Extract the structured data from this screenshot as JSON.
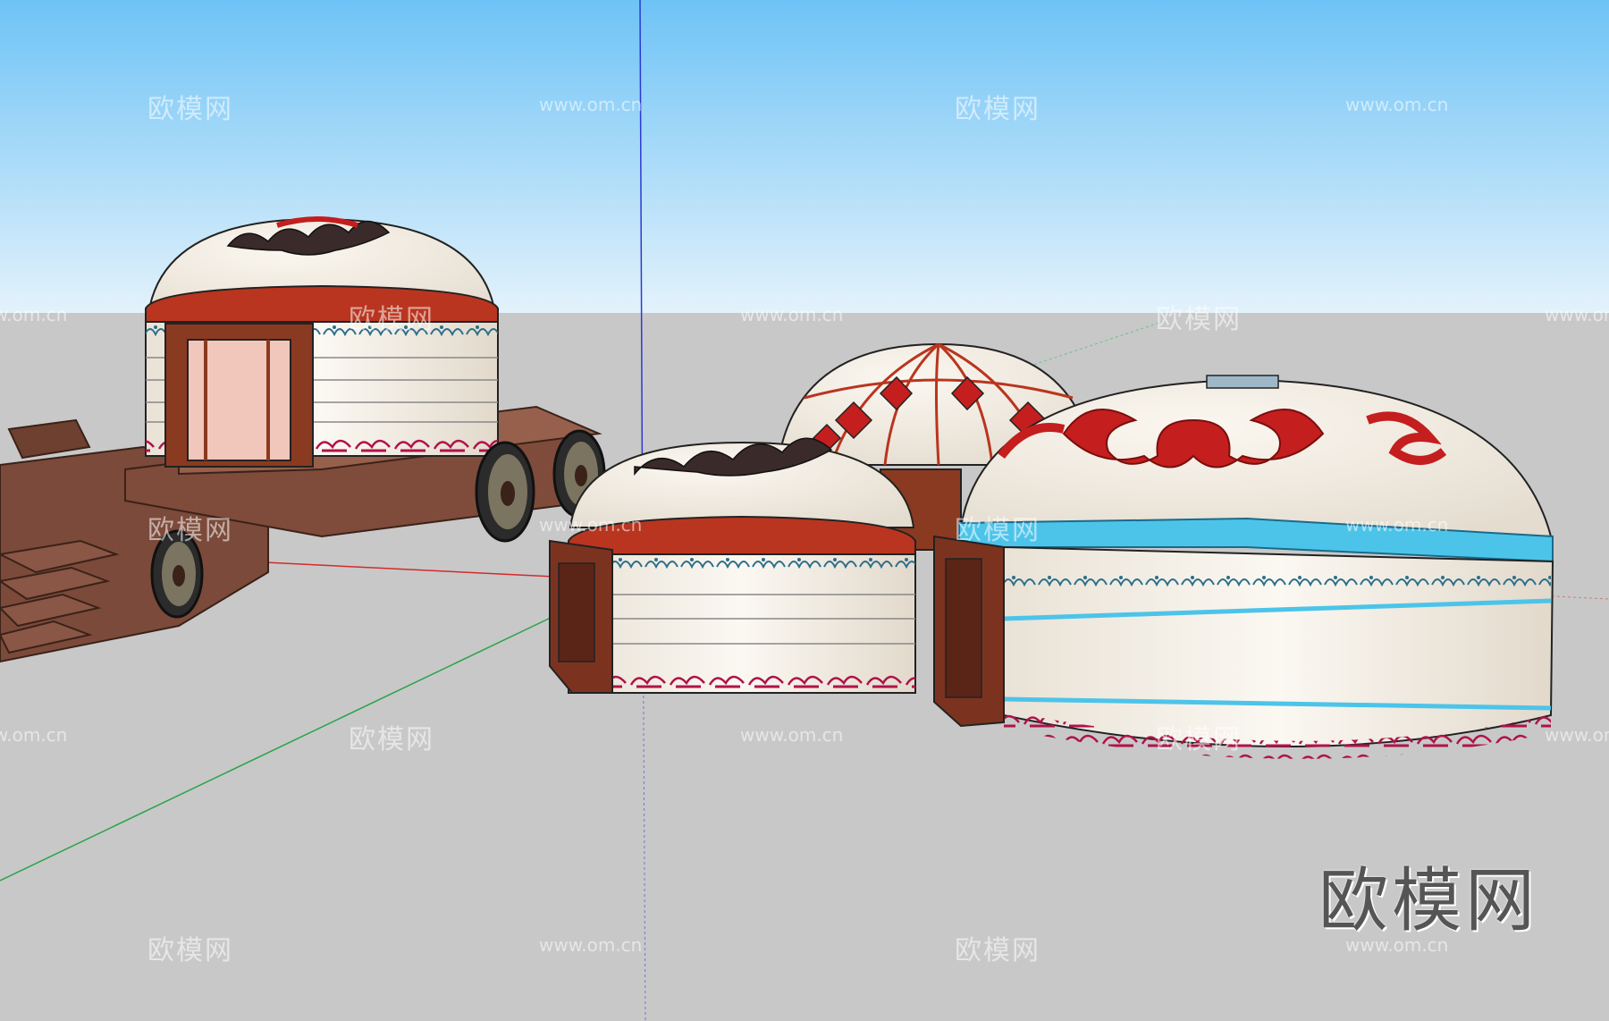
{
  "watermarks": {
    "logo_text": "欧模网",
    "url_text": "www.om.cn",
    "big_logo": "欧模网"
  },
  "colors": {
    "sky_top": "#6ec3f6",
    "sky_bottom": "#e0f0fb",
    "ground": "#c8c8c8",
    "axis_blue": "#2a3bd1",
    "axis_red": "#d42a2a",
    "axis_green": "#2aa34a",
    "yurt_white": "#f2ece2",
    "yurt_red": "#b9351f",
    "wood": "#7b4a3a",
    "trim_blue": "#4cc4ea",
    "pattern_red": "#c41e1e"
  },
  "scene": {
    "objects": [
      "cart-yurt",
      "small-yurt",
      "patterned-dome-yurt",
      "large-blue-trim-yurt"
    ]
  }
}
